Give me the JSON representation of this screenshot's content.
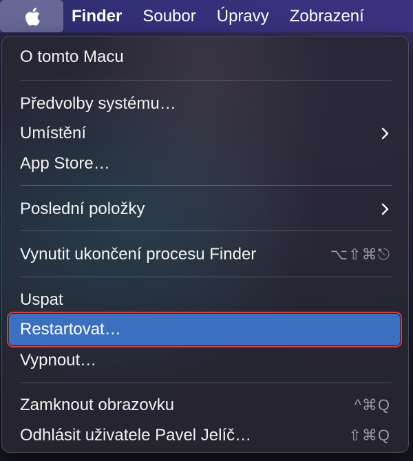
{
  "menubar": {
    "apple_icon": "apple-logo-icon",
    "items": [
      "Finder",
      "Soubor",
      "Úpravy",
      "Zobrazení"
    ]
  },
  "menu": {
    "about": "O tomto Macu",
    "system_prefs": "Předvolby systému…",
    "location": "Umístění",
    "app_store": "App Store…",
    "recent_items": "Poslední položky",
    "force_quit": "Vynutit ukončení procesu Finder",
    "force_quit_shortcut": "⌥⇧⌘⎋",
    "sleep": "Uspat",
    "restart": "Restartovat…",
    "shutdown": "Vypnout…",
    "lock_screen": "Zamknout obrazovku",
    "lock_screen_shortcut": "^⌘Q",
    "logout": "Odhlásit uživatele Pavel Jelíč…",
    "logout_shortcut": "⇧⌘Q"
  },
  "colors": {
    "highlight": "#3b6fc0",
    "annotation_outline": "#d83b3b"
  }
}
